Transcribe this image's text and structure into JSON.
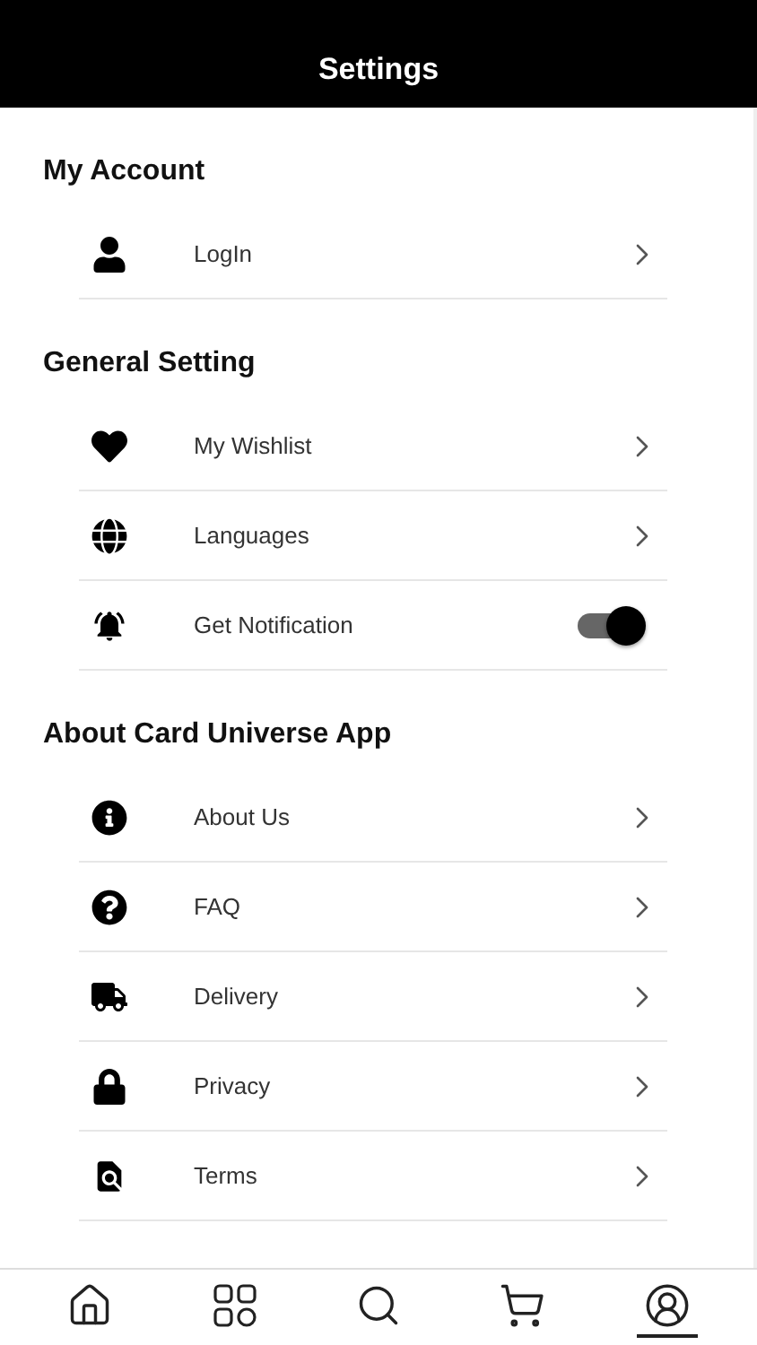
{
  "header": {
    "title": "Settings"
  },
  "sections": [
    {
      "title": "My Account",
      "items": [
        {
          "kind": "link",
          "label": "LogIn"
        }
      ]
    },
    {
      "title": "General Setting",
      "items": [
        {
          "kind": "link",
          "label": "My Wishlist"
        },
        {
          "kind": "link",
          "label": "Languages"
        },
        {
          "kind": "toggle",
          "label": "Get Notification",
          "on": true
        }
      ]
    },
    {
      "title": "About Card Universe  App",
      "items": [
        {
          "kind": "link",
          "label": "About Us"
        },
        {
          "kind": "link",
          "label": "FAQ"
        },
        {
          "kind": "link",
          "label": "Delivery"
        },
        {
          "kind": "link",
          "label": "Privacy"
        },
        {
          "kind": "link",
          "label": "Terms"
        }
      ]
    }
  ],
  "tab_bar": [
    {
      "selected": false
    },
    {
      "selected": false
    },
    {
      "selected": false
    },
    {
      "selected": false
    },
    {
      "selected": true
    }
  ]
}
